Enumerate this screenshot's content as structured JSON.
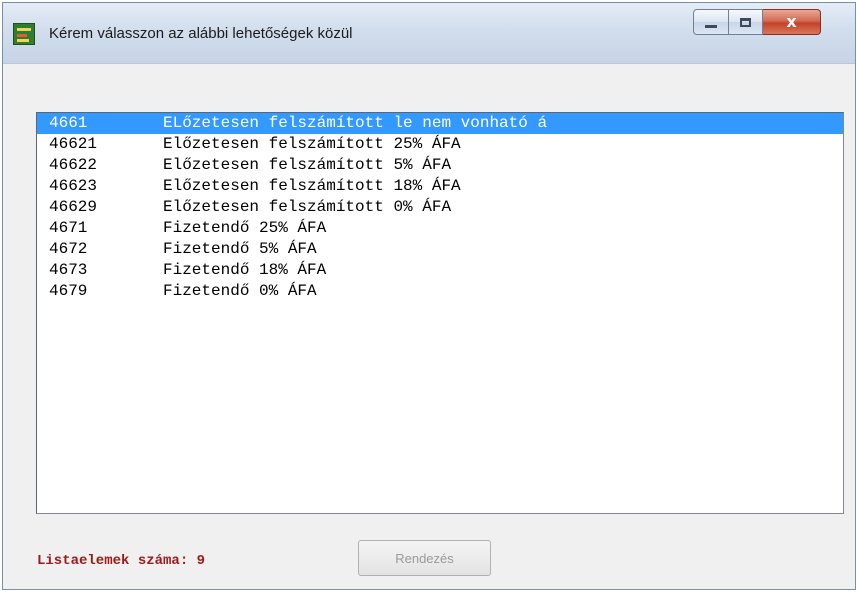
{
  "window": {
    "title": "Kérem válasszon az alábbi lehetőségek közül",
    "close_glyph": "x"
  },
  "list": {
    "items": [
      {
        "code": "4661",
        "description": "ELőzetesen felszámított le nem vonható á",
        "selected": true
      },
      {
        "code": "46621",
        "description": "Előzetesen felszámított 25% ÁFA",
        "selected": false
      },
      {
        "code": "46622",
        "description": "Előzetesen felszámított 5% ÁFA",
        "selected": false
      },
      {
        "code": "46623",
        "description": "Előzetesen felszámított 18% ÁFA",
        "selected": false
      },
      {
        "code": "46629",
        "description": "Előzetesen felszámított 0% ÁFA",
        "selected": false
      },
      {
        "code": "4671",
        "description": "Fizetendő 25% ÁFA",
        "selected": false
      },
      {
        "code": "4672",
        "description": "Fizetendő 5% ÁFA",
        "selected": false
      },
      {
        "code": "4673",
        "description": "Fizetendő 18% ÁFA",
        "selected": false
      },
      {
        "code": "4679",
        "description": "Fizetendő 0% ÁFA",
        "selected": false
      }
    ]
  },
  "footer": {
    "count_label": "Listaelemek száma: 9",
    "sort_button_label": "Rendezés",
    "sort_button_enabled": false
  },
  "colors": {
    "selection": "#3399ff",
    "count_label": "#9b1a1a"
  },
  "icons": {
    "app": "app-icon",
    "minimize": "minimize-icon",
    "maximize": "maximize-icon",
    "close": "close-icon"
  }
}
